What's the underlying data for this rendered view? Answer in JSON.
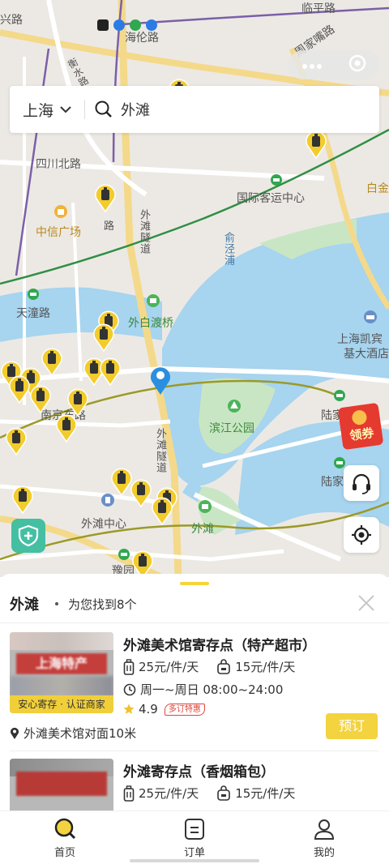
{
  "colors": {
    "accent": "#f3d33f",
    "pin": "#f2cc2c",
    "water": "#a7d4ef",
    "park": "#c9e6c4",
    "coupon": "#e53a2f"
  },
  "map": {
    "labels": {
      "xinglu": "兴路",
      "linpinglu": "临平路",
      "hailunlu": "海伦路",
      "sichuanbeilu": "四川北路",
      "zhouranzuilu": "周家嘴路",
      "guojikeyun": "国际客运中心",
      "baijin": "白金",
      "zhongxin": "中信广场",
      "waitansuidao1": "外滩隧道",
      "yujingpu": "俞泾浦",
      "tiantonglu": "天潼路",
      "waibaidu": "外白渡桥",
      "kaibin": "上海凯宾",
      "kaibin2": "基大酒店",
      "nanjinglu": "南京东路",
      "lujia1": "陆家",
      "binjiang": "滨江公园",
      "waitansuidao2": "外滩隧道",
      "lujia2": "陆家",
      "waitanzhongxin": "外滩中心",
      "waitan": "外滩",
      "yuyuan": "豫园",
      "hengbeilu": "衡水路",
      "lu": "路"
    },
    "icons": [
      "map-pin-icon",
      "location-marker-icon",
      "metro-station-icon",
      "camera-icon",
      "park-icon"
    ]
  },
  "search": {
    "city": "上海",
    "query": "外滩"
  },
  "coupon": {
    "label": "领券"
  },
  "sheet": {
    "title": "外滩",
    "subtitle": "为您找到8个",
    "cards": [
      {
        "title": "外滩美术馆寄存点（特产超市）",
        "sign": "上海特产",
        "badge": "安心寄存 · 认证商家",
        "price_luggage": "25元/件/天",
        "price_bag": "15元/件/天",
        "hours": "周一~周日 08:00~24:00",
        "rating": "4.9",
        "tag": "多订特惠",
        "location": "外滩美术馆对面10米",
        "book": "预订"
      },
      {
        "title": "外滩寄存点（香烟箱包）",
        "sign": "",
        "price_luggage": "25元/件/天",
        "price_bag": "15元/件/天"
      }
    ]
  },
  "nav": {
    "home": "首页",
    "orders": "订单",
    "mine": "我的"
  }
}
